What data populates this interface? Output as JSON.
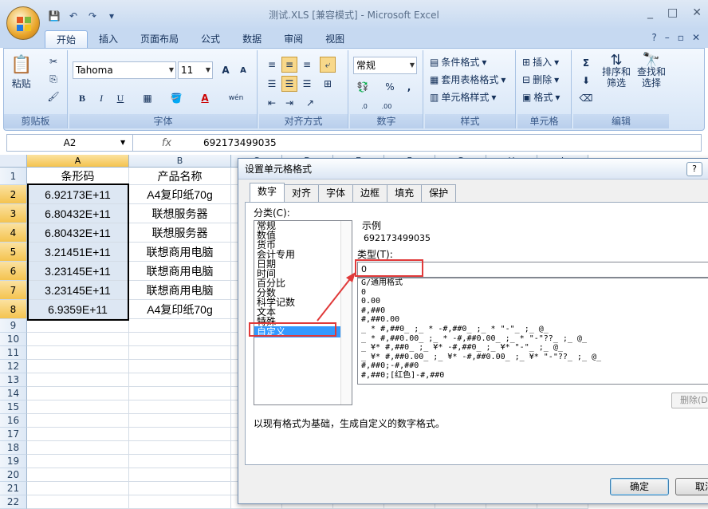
{
  "window": {
    "title": "测试.XLS  [兼容模式] - Microsoft Excel",
    "controls": [
      "_",
      "□",
      "✕"
    ]
  },
  "ribbon_tabs": [
    "开始",
    "插入",
    "页面布局",
    "公式",
    "数据",
    "审阅",
    "视图"
  ],
  "ribbon": {
    "clipboard": {
      "label": "剪贴板",
      "paste": "粘贴"
    },
    "font": {
      "label": "字体",
      "name": "Tahoma",
      "size": "11",
      "grow": "A",
      "shrink": "A",
      "bold": "B",
      "italic": "I",
      "underline": "U",
      "font_color": "A",
      "wen": "wén"
    },
    "alignment": {
      "label": "对齐方式"
    },
    "number": {
      "label": "数字",
      "format": "常规",
      "percent": "%",
      "comma": ","
    },
    "styles": {
      "label": "样式",
      "conditional": "条件格式",
      "table": "套用表格格式",
      "cell_styles": "单元格样式"
    },
    "cells": {
      "label": "单元格",
      "insert": "插入",
      "delete": "删除",
      "format": "格式"
    },
    "editing": {
      "label": "编辑",
      "sigma": "Σ",
      "sort_line1": "排序和",
      "sort_line2": "筛选",
      "find_line1": "查找和",
      "find_line2": "选择"
    }
  },
  "formula_bar": {
    "name_box": "A2",
    "fx": "fx",
    "value": "692173499035"
  },
  "sheet": {
    "columns": [
      {
        "id": "A",
        "selected": true
      },
      {
        "id": "B",
        "selected": false
      },
      {
        "id": "C",
        "selected": false
      },
      {
        "id": "D",
        "selected": false
      },
      {
        "id": "E",
        "selected": false
      },
      {
        "id": "F",
        "selected": false
      },
      {
        "id": "G",
        "selected": false
      },
      {
        "id": "H",
        "selected": false
      },
      {
        "id": "I",
        "selected": false
      }
    ],
    "rows": [
      {
        "num": "1",
        "a": "条形码",
        "b": "产品名称"
      },
      {
        "num": "2",
        "a": "6.92173E+11",
        "b": "A4复印纸70g"
      },
      {
        "num": "3",
        "a": "6.80432E+11",
        "b": "联想服务器"
      },
      {
        "num": "4",
        "a": "6.80432E+11",
        "b": "联想服务器"
      },
      {
        "num": "5",
        "a": "3.21451E+11",
        "b": "联想商用电脑"
      },
      {
        "num": "6",
        "a": "3.23145E+11",
        "b": "联想商用电脑"
      },
      {
        "num": "7",
        "a": "3.23145E+11",
        "b": "联想商用电脑"
      },
      {
        "num": "8",
        "a": "6.9359E+11",
        "b": "A4复印纸70g"
      },
      {
        "num": "9",
        "a": "",
        "b": ""
      },
      {
        "num": "10",
        "a": "",
        "b": ""
      },
      {
        "num": "11",
        "a": "",
        "b": ""
      },
      {
        "num": "12",
        "a": "",
        "b": ""
      },
      {
        "num": "13",
        "a": "",
        "b": ""
      },
      {
        "num": "14",
        "a": "",
        "b": ""
      },
      {
        "num": "15",
        "a": "",
        "b": ""
      },
      {
        "num": "16",
        "a": "",
        "b": ""
      },
      {
        "num": "17",
        "a": "",
        "b": ""
      },
      {
        "num": "18",
        "a": "",
        "b": ""
      },
      {
        "num": "19",
        "a": "",
        "b": ""
      },
      {
        "num": "20",
        "a": "",
        "b": ""
      },
      {
        "num": "21",
        "a": "",
        "b": ""
      },
      {
        "num": "22",
        "a": "",
        "b": ""
      }
    ]
  },
  "dialog": {
    "title": "设置单元格格式",
    "help": "?",
    "tabs": [
      "数字",
      "对齐",
      "字体",
      "边框",
      "填充",
      "保护"
    ],
    "category_label": "分类(C):",
    "categories": [
      "常规",
      "数值",
      "货币",
      "会计专用",
      "日期",
      "时间",
      "百分比",
      "分数",
      "科学记数",
      "文本",
      "特殊",
      "自定义"
    ],
    "selected_category": "自定义",
    "sample_label": "示例",
    "sample_value": "692173499035",
    "type_label": "类型(T):",
    "type_value": "0",
    "format_list": [
      "G/通用格式",
      "0",
      "0.00",
      "#,##0",
      "#,##0.00",
      "_ * #,##0_ ;_ * -#,##0_ ;_ * \"-\"_ ;_ @_",
      "_ * #,##0.00_ ;_ * -#,##0.00_ ;_ * \"-\"??_ ;_ @_",
      "_ ¥* #,##0_ ;_ ¥* -#,##0_ ;_ ¥* \"-\"_ ;_ @_",
      "_ ¥* #,##0.00_ ;_ ¥* -#,##0.00_ ;_ ¥* \"-\"??_ ;_ @_",
      "#,##0;-#,##0",
      "#,##0;[红色]-#,##0"
    ],
    "delete_button": "删除(D)",
    "description": "以现有格式为基础，生成自定义的数字格式。",
    "ok_button": "确定",
    "cancel_button": "取消"
  },
  "colors": {
    "annotation_red": "#e03a3a",
    "selection_blue": "#3399ff"
  }
}
